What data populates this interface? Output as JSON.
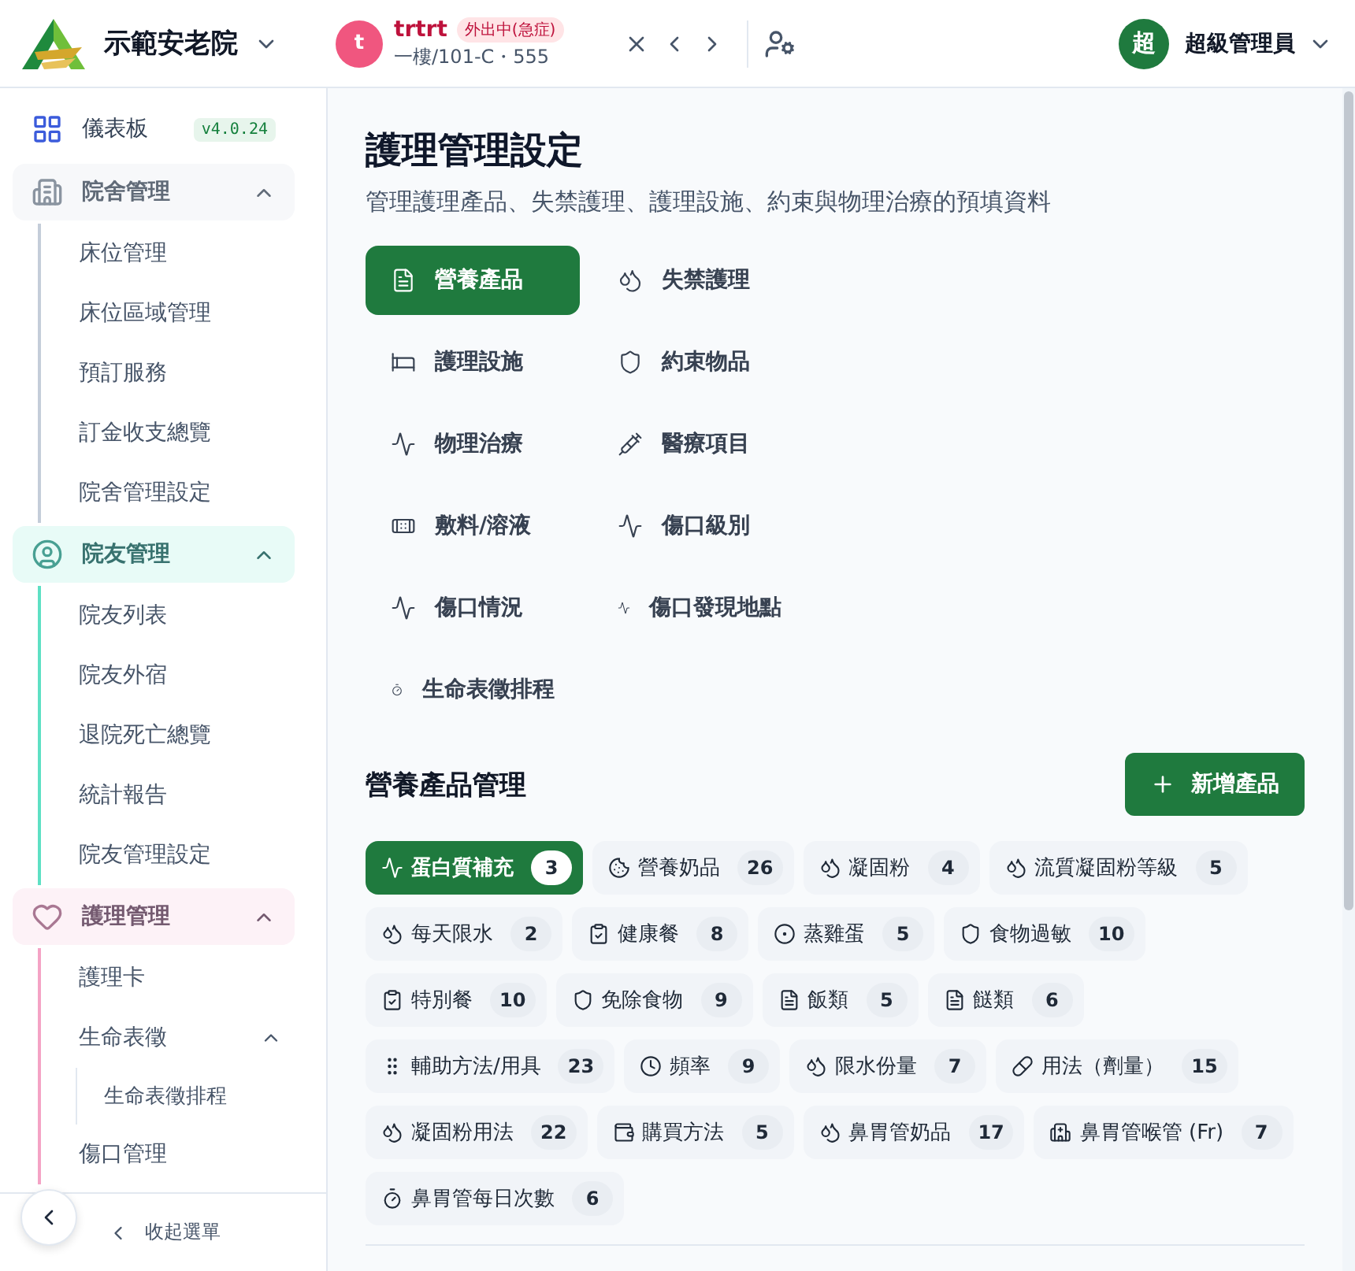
{
  "header": {
    "org_name": "示範安老院",
    "resident": {
      "initial": "t",
      "name": "trtrt",
      "status": "外出中(急症)",
      "location": "一樓/101-C・555"
    },
    "user": {
      "initial": "超",
      "name": "超級管理員"
    }
  },
  "sidebar": {
    "dashboard": {
      "label": "儀表板",
      "version": "v4.0.24"
    },
    "groups": [
      {
        "label": "院舍管理",
        "color": "#c4cdd9",
        "expanded": true,
        "children": [
          {
            "label": "床位管理"
          },
          {
            "label": "床位區域管理"
          },
          {
            "label": "預訂服務"
          },
          {
            "label": "訂金收支總覽"
          },
          {
            "label": "院舍管理設定"
          }
        ]
      },
      {
        "label": "院友管理",
        "color": "#5ee0c4",
        "expanded": true,
        "children": [
          {
            "label": "院友列表"
          },
          {
            "label": "院友外宿"
          },
          {
            "label": "退院死亡總覽"
          },
          {
            "label": "統計報告"
          },
          {
            "label": "院友管理設定"
          }
        ]
      },
      {
        "label": "護理管理",
        "color": "#f4a3c5",
        "expanded": true,
        "children": [
          {
            "label": "護理卡"
          },
          {
            "label": "生命表徵",
            "expanded": true,
            "children": [
              {
                "label": "生命表徵排程"
              }
            ]
          },
          {
            "label": "傷口管理"
          }
        ]
      }
    ],
    "collapse_label": "收起選單"
  },
  "page": {
    "title": "護理管理設定",
    "subtitle": "管理護理產品、失禁護理、護理設施、約束與物理治療的預填資料"
  },
  "tabs": [
    {
      "label": "營養產品",
      "selected": true
    },
    {
      "label": "失禁護理",
      "selected": false
    },
    {
      "label": "護理設施",
      "selected": false
    },
    {
      "label": "約束物品",
      "selected": false
    },
    {
      "label": "物理治療",
      "selected": false
    },
    {
      "label": "醫療項目",
      "selected": false
    },
    {
      "label": "敷料/溶液",
      "selected": false
    },
    {
      "label": "傷口級別",
      "selected": false
    },
    {
      "label": "傷口情況",
      "selected": false
    },
    {
      "label": "傷口發現地點",
      "selected": false
    },
    {
      "label": "生命表徵排程",
      "selected": false
    }
  ],
  "section": {
    "title": "營養產品管理",
    "add_button": "新增產品"
  },
  "categories": [
    {
      "label": "蛋白質補充",
      "count": "3",
      "selected": true
    },
    {
      "label": "營養奶品",
      "count": "26",
      "selected": false
    },
    {
      "label": "凝固粉",
      "count": "4",
      "selected": false
    },
    {
      "label": "流質凝固粉等級",
      "count": "5",
      "selected": false
    },
    {
      "label": "每天限水",
      "count": "2",
      "selected": false
    },
    {
      "label": "健康餐",
      "count": "8",
      "selected": false
    },
    {
      "label": "蒸雞蛋",
      "count": "5",
      "selected": false
    },
    {
      "label": "食物過敏",
      "count": "10",
      "selected": false
    },
    {
      "label": "特別餐",
      "count": "10",
      "selected": false
    },
    {
      "label": "免除食物",
      "count": "9",
      "selected": false
    },
    {
      "label": "飯類",
      "count": "5",
      "selected": false
    },
    {
      "label": "餸類",
      "count": "6",
      "selected": false
    },
    {
      "label": "輔助方法/用具",
      "count": "23",
      "selected": false
    },
    {
      "label": "頻率",
      "count": "9",
      "selected": false
    },
    {
      "label": "限水份量",
      "count": "7",
      "selected": false
    },
    {
      "label": "用法（劑量）",
      "count": "15",
      "selected": false
    },
    {
      "label": "凝固粉用法",
      "count": "22",
      "selected": false
    },
    {
      "label": "購買方法",
      "count": "5",
      "selected": false
    },
    {
      "label": "鼻胃管奶品",
      "count": "17",
      "selected": false
    },
    {
      "label": "鼻胃管喉管 (Fr)",
      "count": "7",
      "selected": false
    },
    {
      "label": "鼻胃管每日次數",
      "count": "6",
      "selected": false
    }
  ]
}
